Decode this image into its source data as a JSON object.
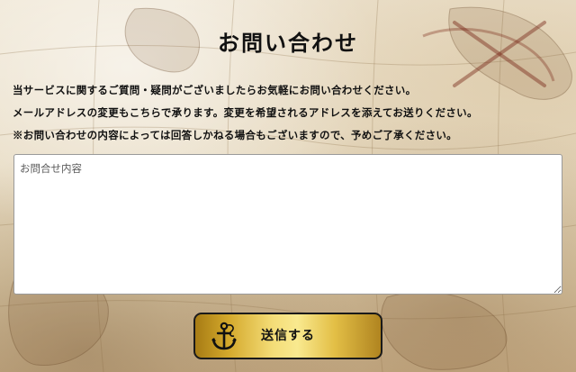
{
  "page": {
    "title": "お問い合わせ"
  },
  "description": {
    "line1": "当サービスに関するご質問・疑問がございましたらお気軽にお問い合わせください。",
    "line2": "メールアドレスの変更もこちらで承ります。変更を希望されるアドレスを添えてお送りください。",
    "line3": "※お問い合わせの内容によっては回答しかねる場合もございますので、予めご了承ください。"
  },
  "form": {
    "message_placeholder": "お問合せ内容",
    "message_value": "",
    "submit_label": "送信する",
    "submit_icon": "anchor-icon"
  },
  "colors": {
    "text": "#111111",
    "button_gold_light": "#f9e98f",
    "button_gold_dark": "#a77c14",
    "button_border": "#1a1a1a",
    "background_parchment": "#e8dcc4"
  }
}
